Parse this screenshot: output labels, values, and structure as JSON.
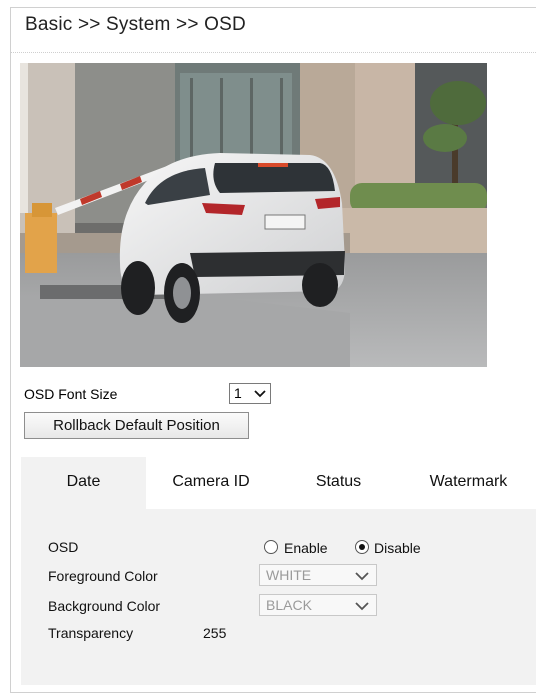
{
  "breadcrumb": "Basic >> System >> OSD",
  "camera_preview": {
    "content": "live-camera-image"
  },
  "font_size": {
    "label": "OSD Font Size",
    "value": "1"
  },
  "rollback_button": "Rollback Default Position",
  "tabs": [
    {
      "label": "Date",
      "active": true
    },
    {
      "label": "Camera ID",
      "active": false
    },
    {
      "label": "Status",
      "active": false
    },
    {
      "label": "Watermark",
      "active": false
    }
  ],
  "osd": {
    "label": "OSD",
    "enable_label": "Enable",
    "disable_label": "Disable",
    "selected": "Disable"
  },
  "foreground": {
    "label": "Foreground Color",
    "value": "WHITE"
  },
  "background": {
    "label": "Background Color",
    "value": "BLACK"
  },
  "transparency": {
    "label": "Transparency",
    "value": "255"
  },
  "colors": {
    "panel": "#f2f2f2",
    "border": "#d0d0d0"
  }
}
